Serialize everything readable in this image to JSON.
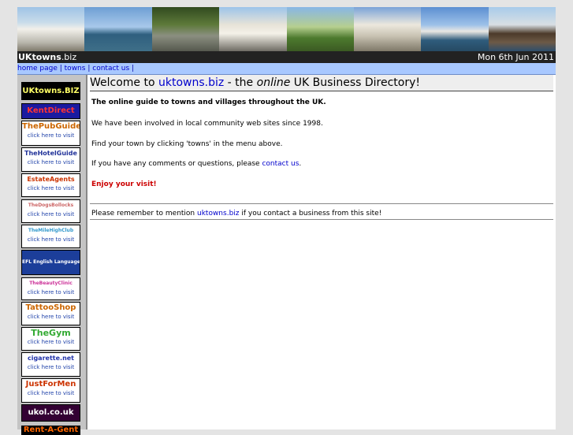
{
  "header": {
    "site_name_strong": "UKtowns",
    "site_name_suffix": ".biz",
    "date": "Mon 6th Jun 2011"
  },
  "nav": {
    "items": [
      "home page",
      "towns",
      "contact us"
    ],
    "separator": "|"
  },
  "main": {
    "welcome": {
      "prefix": "Welcome to ",
      "site": "uktowns.biz",
      "middle": " - the ",
      "emph": "online",
      "suffix": " UK Business Directory!"
    },
    "intro": "The online guide to towns and villages throughout the UK.",
    "involved": "We have been involved in local community web sites since 1998.",
    "find": "Find your town by clicking 'towns' in the menu above.",
    "questions_prefix": "If you have any comments or questions, please ",
    "questions_link": "contact us",
    "questions_suffix": ".",
    "enjoy": "Enjoy your visit!",
    "remember_prefix": "Please remember to mention ",
    "remember_link": "uktowns.biz",
    "remember_suffix": " if you contact a business from this site!"
  },
  "sidebar": {
    "ads": [
      {
        "title": "UKtowns.BIZ",
        "sub": "",
        "bg": "#000000",
        "fg": "#ffff66"
      },
      {
        "title": "KentDirect",
        "sub": "",
        "bg": "#1a1aa0",
        "fg": "#ff3333"
      },
      {
        "title": "ThePubGuide",
        "sub": "click here to visit",
        "bg": "#ffffff",
        "fg": "#cc6600"
      },
      {
        "title": "TheHotelGuide",
        "sub": "click here to visit",
        "bg": "#ffffff",
        "fg": "#223399"
      },
      {
        "title": "EstateAgents",
        "sub": "click here to visit",
        "bg": "#ffffff",
        "fg": "#cc3300"
      },
      {
        "title": "TheDogsBollocks",
        "sub": "click here to visit",
        "bg": "#ffffff",
        "fg": "#cc6666"
      },
      {
        "title": "TheMileHighClub",
        "sub": "click here to visit",
        "bg": "#ffffff",
        "fg": "#3399cc"
      },
      {
        "title": "EFL English Language",
        "sub": "",
        "bg": "#1c3e9a",
        "fg": "#ffffff"
      },
      {
        "title": "TheBeautyClinic",
        "sub": "click here to visit",
        "bg": "#ffffff",
        "fg": "#cc3399"
      },
      {
        "title": "TattooShop",
        "sub": "click here to visit",
        "bg": "#ffffff",
        "fg": "#cc6600"
      },
      {
        "title": "TheGym",
        "sub": "click here to visit",
        "bg": "#ffffff",
        "fg": "#33aa33"
      },
      {
        "title": "cigarette.net",
        "sub": "click here to visit",
        "bg": "#ffffff",
        "fg": "#2233aa"
      },
      {
        "title": "JustForMen",
        "sub": "click here to visit",
        "bg": "#ffffff",
        "fg": "#cc3300"
      },
      {
        "title": "ukol.co.uk",
        "sub": "",
        "bg": "#330033",
        "fg": "#ffffff"
      },
      {
        "title": "Rent-A-Gent",
        "sub": "",
        "bg": "#000000",
        "fg": "#ff6600"
      }
    ]
  },
  "colors": {
    "link": "#0000cc",
    "enjoy": "#cc0000",
    "nav_bg": "#a8c8ff",
    "titlebar_bg": "#222222"
  }
}
